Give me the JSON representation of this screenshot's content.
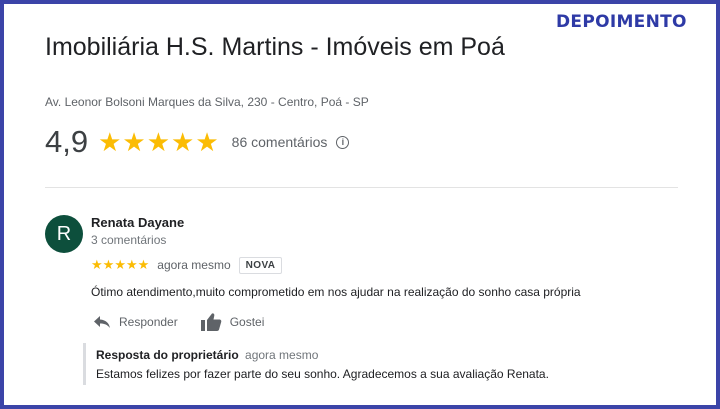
{
  "tag": "DEPOIMENTO",
  "business": {
    "title": "Imobiliária H.S. Martins - Imóveis em Poá",
    "address": "Av. Leonor Bolsoni Marques da Silva, 230 - Centro, Poá - SP",
    "rating": "4,9",
    "stars": 5,
    "reviews_count": "86 comentários"
  },
  "review": {
    "avatar_letter": "R",
    "author": "Renata Dayane",
    "author_meta": "3 comentários",
    "stars": 5,
    "time": "agora mesmo",
    "badge": "NOVA",
    "text": "Ótimo atendimento,muito comprometido em nos ajudar na realização do sonho casa própria",
    "actions": {
      "reply": "Responder",
      "like": "Gostei"
    }
  },
  "owner_reply": {
    "label": "Resposta do proprietário",
    "time": "agora mesmo",
    "text": "Estamos felizes por fazer parte do seu sonho. Agradecemos a sua avaliação Renata."
  },
  "colors": {
    "frame": "#3b44a8",
    "star": "#fbbc04",
    "avatar": "#0d4f3c"
  }
}
